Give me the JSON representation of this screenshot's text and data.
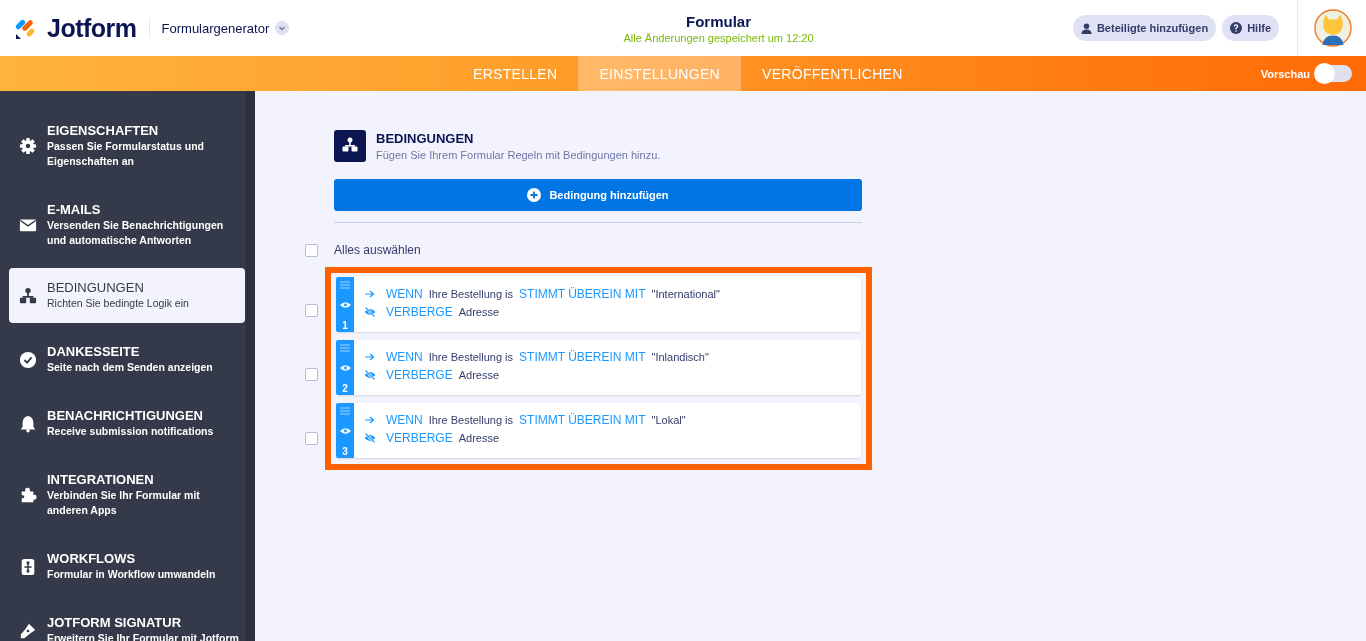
{
  "header": {
    "brand": "Jotform",
    "builder_menu": "Formulargenerator",
    "title": "Formular",
    "save_status": "Alle Änderungen gespeichert um 12:20",
    "invite_button": "Beteiligte hinzufügen",
    "help_button": "Hilfe"
  },
  "tabs": [
    {
      "label": "ERSTELLEN",
      "selected": false
    },
    {
      "label": "EINSTELLUNGEN",
      "selected": true
    },
    {
      "label": "VERÖFFENTLICHEN",
      "selected": false
    }
  ],
  "preview": {
    "label": "Vorschau",
    "on": false
  },
  "sidebar": {
    "items": [
      {
        "kind": "gear",
        "title": "EIGENSCHAFTEN",
        "description": "Passen Sie Formularstatus und Eigenschaften an",
        "selected": false
      },
      {
        "kind": "mail",
        "title": "E-MAILS",
        "description": "Versenden Sie Benachrichtigungen und automatische Antworten",
        "selected": false
      },
      {
        "kind": "tree",
        "title": "BEDINGUNGEN",
        "description": "Richten Sie bedingte Logik ein",
        "selected": true
      },
      {
        "kind": "check",
        "title": "DANKESSEITE",
        "description": "Seite nach dem Senden anzeigen",
        "selected": false
      },
      {
        "kind": "bell",
        "title": "BENACHRICHTIGUNGEN",
        "description": "Receive submission notifications",
        "selected": false
      },
      {
        "kind": "puzzle",
        "title": "INTEGRATIONEN",
        "description": "Verbinden Sie Ihr Formular mit anderen Apps",
        "selected": false
      },
      {
        "kind": "workflow",
        "title": "WORKFLOWS",
        "description": "Formular in Workflow umwandeln",
        "selected": false
      },
      {
        "kind": "pen",
        "title": "JOTFORM SIGNATUR",
        "description": "Erweitern Sie Ihr Formular mit Jotform",
        "selected": false
      }
    ]
  },
  "section": {
    "title": "BEDINGUNGEN",
    "subtitle": "Fügen Sie Ihrem Formular Regeln mit Bedingungen hinzu.",
    "add_button": "Bedingung hinzufügen",
    "select_all": {
      "label": "Alles auswählen",
      "checked": false
    }
  },
  "rules": [
    {
      "number": "1",
      "checked": false,
      "condition": {
        "keyword": "WENN",
        "field": "Ihre Bestellung is",
        "operator": "STIMMT ÜBEREIN MIT",
        "value": "\"International\""
      },
      "action": {
        "keyword": "VERBERGE",
        "target": "Adresse"
      }
    },
    {
      "number": "2",
      "checked": false,
      "condition": {
        "keyword": "WENN",
        "field": "Ihre Bestellung is",
        "operator": "STIMMT ÜBEREIN MIT",
        "value": "\"Inlandisch\""
      },
      "action": {
        "keyword": "VERBERGE",
        "target": "Adresse"
      }
    },
    {
      "number": "3",
      "checked": false,
      "condition": {
        "keyword": "WENN",
        "field": "Ihre Bestellung is",
        "operator": "STIMMT ÜBEREIN MIT",
        "value": "\"Lokal\""
      },
      "action": {
        "keyword": "VERBERGE",
        "target": "Adresse"
      }
    }
  ]
}
